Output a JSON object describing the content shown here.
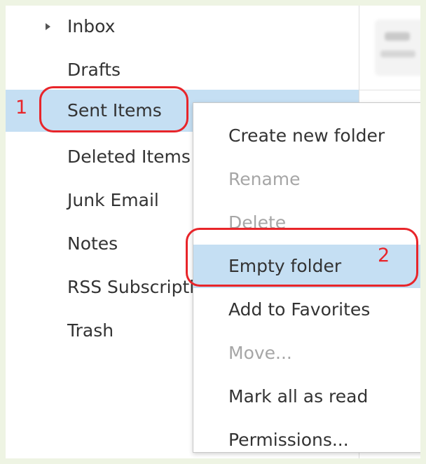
{
  "folders": [
    {
      "label": "Inbox",
      "expandable": true
    },
    {
      "label": "Drafts"
    },
    {
      "label": "Sent Items",
      "selected": true
    },
    {
      "label": "Deleted Items"
    },
    {
      "label": "Junk Email"
    },
    {
      "label": "Notes"
    },
    {
      "label": "RSS Subscriptions"
    },
    {
      "label": "Trash"
    }
  ],
  "context_menu": {
    "items": [
      {
        "label": "Create new folder",
        "enabled": true
      },
      {
        "label": "Rename",
        "enabled": false
      },
      {
        "label": "Delete",
        "enabled": false
      },
      {
        "label": "Empty folder",
        "enabled": true,
        "hovered": true
      },
      {
        "label": "Add to Favorites",
        "enabled": true
      },
      {
        "label": "Move...",
        "enabled": false
      },
      {
        "label": "Mark all as read",
        "enabled": true
      },
      {
        "label": "Permissions...",
        "enabled": true
      }
    ]
  },
  "annotations": {
    "step1": "1",
    "step2": "2",
    "color": "#e8252a"
  },
  "colors": {
    "selection": "#c5dff3",
    "background": "#eef4e3",
    "text": "#333333",
    "disabled_text": "#a6a6a6"
  },
  "icons": {
    "expand_caret": "caret-right-icon"
  }
}
